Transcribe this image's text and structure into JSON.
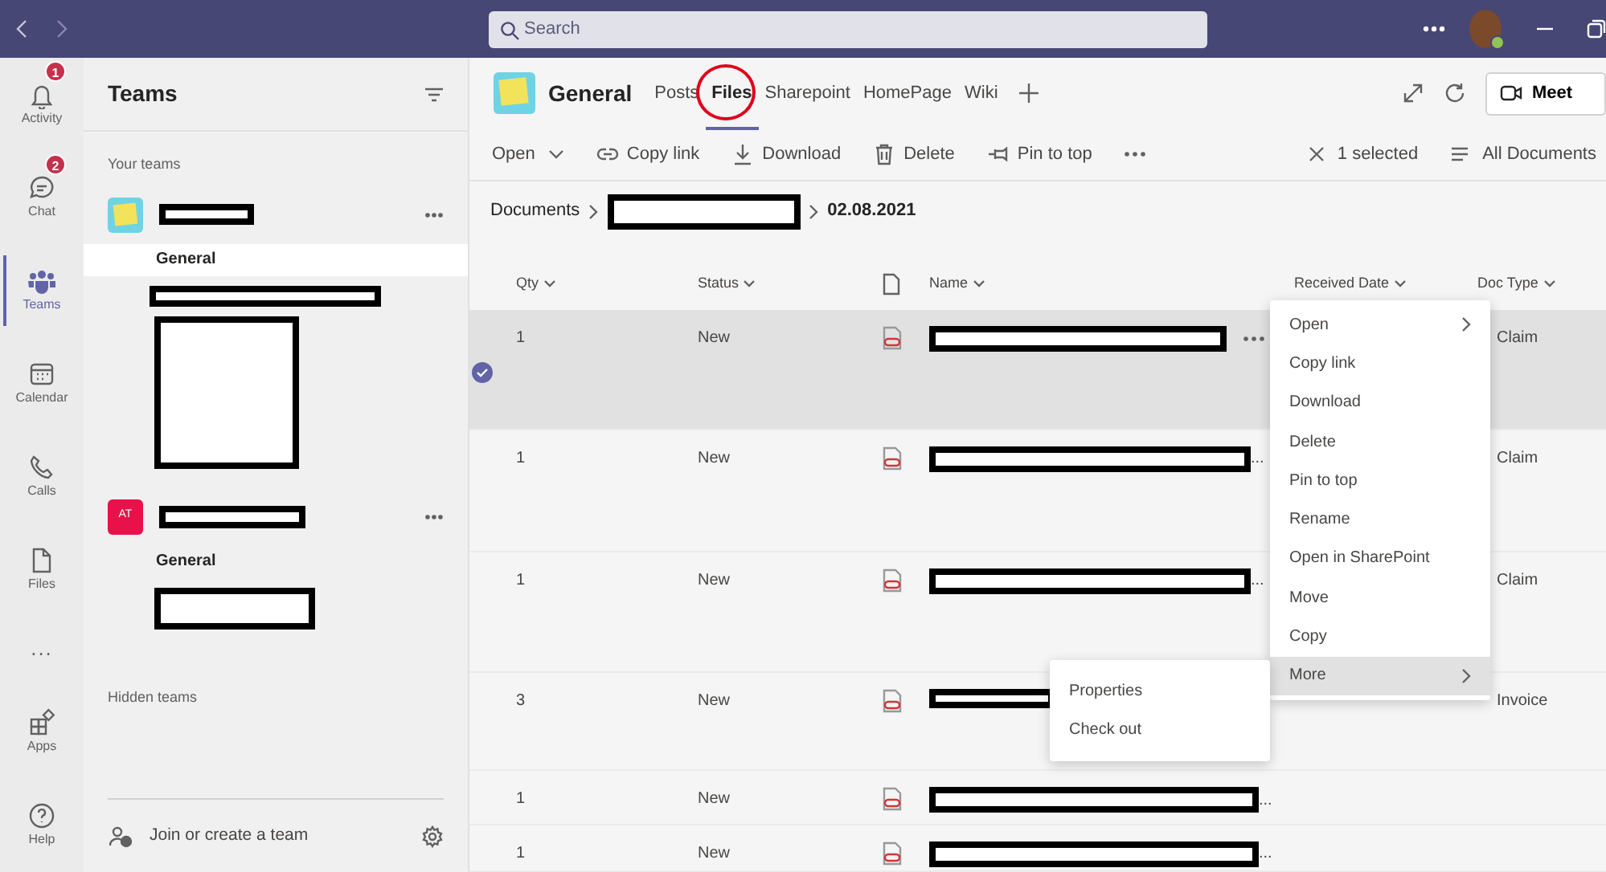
{
  "title_bar": {
    "search": {
      "placeholder": "Search"
    }
  },
  "rail": [
    {
      "kind": "activity",
      "label": "Activity",
      "badge": "1",
      "selected": false
    },
    {
      "kind": "chat",
      "label": "Chat",
      "badge": "2",
      "selected": false
    },
    {
      "kind": "teams",
      "label": "Teams",
      "selected": true
    },
    {
      "kind": "calendar",
      "label": "Calendar",
      "selected": false
    },
    {
      "kind": "calls",
      "label": "Calls",
      "selected": false
    },
    {
      "kind": "files",
      "label": "Files",
      "selected": false
    },
    {
      "kind": "more",
      "label": "...",
      "selected": false
    }
  ],
  "rail_bottom": [
    {
      "kind": "apps",
      "label": "Apps",
      "selected": false
    },
    {
      "kind": "help",
      "label": "Help",
      "selected": false
    }
  ],
  "teams_panel": {
    "title": "Teams",
    "section": "Your teams",
    "teams": [
      {
        "avatar": {
          "kind": "image"
        },
        "channels": [
          {
            "label": "General",
            "selected": true
          }
        ]
      },
      {
        "avatar": {
          "kind": "initials",
          "text": "AT",
          "color": "#e8114a"
        },
        "channels": [
          {
            "label": "General",
            "selected": false
          }
        ]
      }
    ],
    "hidden_section": "Hidden teams",
    "join": "Join or create a team"
  },
  "channel": {
    "title": "General",
    "tabs": [
      {
        "label": "Posts",
        "selected": false,
        "circled": false
      },
      {
        "label": "Files",
        "selected": true,
        "circled": true
      },
      {
        "label": "Sharepoint",
        "selected": false,
        "circled": false
      },
      {
        "label": "HomePage",
        "selected": false,
        "circled": false
      },
      {
        "label": "Wiki",
        "selected": false,
        "circled": false
      }
    ],
    "meet": "Meet"
  },
  "toolbar": {
    "commands": [
      {
        "kind": "open",
        "label": "Open"
      },
      {
        "kind": "link",
        "label": "Copy link"
      },
      {
        "kind": "download",
        "label": "Download"
      },
      {
        "kind": "delete",
        "label": "Delete"
      },
      {
        "kind": "pin",
        "label": "Pin to top"
      }
    ],
    "selection": "1 selected",
    "view": "All Documents"
  },
  "breadcrumb": {
    "root": "Documents",
    "current": "02.08.2021"
  },
  "table": {
    "columns": [
      "Qty",
      "Status",
      "Name",
      "Received Date",
      "Doc Type"
    ],
    "rows": [
      {
        "qty": "1",
        "status": "New",
        "name_tail": "",
        "doc_type": "Claim",
        "selected": true
      },
      {
        "qty": "1",
        "status": "New",
        "name_tail": "...",
        "doc_type": "Claim",
        "selected": false
      },
      {
        "qty": "1",
        "status": "New",
        "name_tail": "...",
        "doc_type": "Claim",
        "selected": false
      },
      {
        "qty": "3",
        "status": "New",
        "name_tail": "",
        "doc_type": "Invoice",
        "selected": false
      },
      {
        "qty": "1",
        "status": "New",
        "name_tail": "...",
        "doc_type": "",
        "selected": false
      },
      {
        "qty": "1",
        "status": "New",
        "name_tail": "...",
        "doc_type": "",
        "selected": false
      }
    ]
  },
  "context_menu": {
    "items": [
      {
        "label": "Open",
        "submenu": true,
        "selected": false
      },
      {
        "label": "Copy link",
        "submenu": false,
        "selected": false
      },
      {
        "label": "Download",
        "submenu": false,
        "selected": false
      },
      {
        "label": "Delete",
        "submenu": false,
        "selected": false
      },
      {
        "label": "Pin to top",
        "submenu": false,
        "selected": false
      },
      {
        "label": "Rename",
        "submenu": false,
        "selected": false
      },
      {
        "label": "Open in SharePoint",
        "submenu": false,
        "selected": false
      },
      {
        "label": "Move",
        "submenu": false,
        "selected": false
      },
      {
        "label": "Copy",
        "submenu": false,
        "selected": false
      },
      {
        "label": "More",
        "submenu": true,
        "selected": true
      }
    ],
    "submenu": [
      "Properties",
      "Check out"
    ]
  }
}
